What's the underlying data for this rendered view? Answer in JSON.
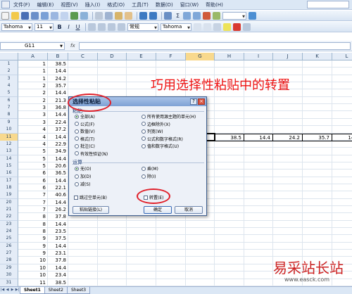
{
  "menubar": {
    "items": [
      {
        "label": "文件(F)",
        "name": "menu-file"
      },
      {
        "label": "编辑(E)",
        "name": "menu-edit"
      },
      {
        "label": "视图(V)",
        "name": "menu-view"
      },
      {
        "label": "插入(I)",
        "name": "menu-insert"
      },
      {
        "label": "格式(O)",
        "name": "menu-format"
      },
      {
        "label": "工具(T)",
        "name": "menu-tools"
      },
      {
        "label": "数据(D)",
        "name": "menu-data"
      },
      {
        "label": "窗口(W)",
        "name": "menu-window"
      },
      {
        "label": "帮助(H)",
        "name": "menu-help"
      }
    ]
  },
  "toolbar": {
    "font_name": "Tahoma",
    "font_size": "11",
    "style_combo": "常规",
    "style_font": "Tahoma",
    "bold": "B",
    "italic": "I",
    "underline": "U"
  },
  "formula_bar": {
    "name_box": "G11",
    "fx": "fx"
  },
  "columns": [
    "A",
    "B",
    "C",
    "D",
    "E",
    "F",
    "G",
    "H",
    "I",
    "J",
    "K",
    "L"
  ],
  "selected_column": "G",
  "rows": [
    {
      "num": "1",
      "a": "1",
      "b": "38.5"
    },
    {
      "num": "2",
      "a": "1",
      "b": "14.4"
    },
    {
      "num": "3",
      "a": "1",
      "b": "24.2"
    },
    {
      "num": "4",
      "a": "2",
      "b": "35.7"
    },
    {
      "num": "5",
      "a": "2",
      "b": "14.4"
    },
    {
      "num": "6",
      "a": "2",
      "b": "21.3"
    },
    {
      "num": "7",
      "a": "3",
      "b": "36.8"
    },
    {
      "num": "8",
      "a": "3",
      "b": "14.4"
    },
    {
      "num": "9",
      "a": "3",
      "b": "22.4"
    },
    {
      "num": "10",
      "a": "4",
      "b": "37.2"
    },
    {
      "num": "11",
      "a": "4",
      "b": "14.4"
    },
    {
      "num": "12",
      "a": "4",
      "b": "22.9"
    },
    {
      "num": "13",
      "a": "5",
      "b": "34.9"
    },
    {
      "num": "14",
      "a": "5",
      "b": "14.4"
    },
    {
      "num": "15",
      "a": "5",
      "b": "20.6"
    },
    {
      "num": "16",
      "a": "6",
      "b": "36.5"
    },
    {
      "num": "17",
      "a": "6",
      "b": "14.4"
    },
    {
      "num": "18",
      "a": "6",
      "b": "22.1"
    },
    {
      "num": "19",
      "a": "7",
      "b": "40.6"
    },
    {
      "num": "20",
      "a": "7",
      "b": "14.4"
    },
    {
      "num": "21",
      "a": "7",
      "b": "26.2"
    },
    {
      "num": "22",
      "a": "8",
      "b": "37.8"
    },
    {
      "num": "23",
      "a": "8",
      "b": "14.4"
    },
    {
      "num": "24",
      "a": "8",
      "b": "23.5"
    },
    {
      "num": "25",
      "a": "9",
      "b": "37.5"
    },
    {
      "num": "26",
      "a": "9",
      "b": "14.4"
    },
    {
      "num": "27",
      "a": "9",
      "b": "23.1"
    },
    {
      "num": "28",
      "a": "10",
      "b": "37.8"
    },
    {
      "num": "29",
      "a": "10",
      "b": "14.4"
    },
    {
      "num": "30",
      "a": "10",
      "b": "23.4"
    },
    {
      "num": "31",
      "a": "11",
      "b": "38.5"
    }
  ],
  "selected_row": "11",
  "transposed_row": {
    "g": "",
    "h": "38.5",
    "i": "14.4",
    "j": "24.2",
    "k": "35.7",
    "l": "14.4"
  },
  "title_text": "巧用选择性粘贴中的转置",
  "sheets": [
    "Sheet1",
    "Sheet2",
    "Sheet3"
  ],
  "active_sheet": "Sheet1",
  "dialog": {
    "title": "选择性粘贴",
    "paste_group": "粘贴",
    "paste_left": [
      "全部(A)",
      "公式(F)",
      "数值(V)",
      "格式(T)",
      "批注(C)",
      "有效性验证(N)"
    ],
    "paste_right": [
      "所有使用源主题的单元(H)",
      "边框除外(X)",
      "列宽(W)",
      "公式和数字格式(R)",
      "值和数字格式(U)"
    ],
    "operation_group": "运算",
    "op_left": [
      "无(O)",
      "加(D)",
      "减(S)"
    ],
    "op_right": [
      "乘(M)",
      "除(I)"
    ],
    "skip_blanks": "跳过空单元(B)",
    "transpose": "转置(E)",
    "paste_link": "粘贴链接(L)",
    "ok": "确定",
    "cancel": "取消",
    "help": "?",
    "close": "×"
  },
  "watermark": {
    "cn": "易采站长站",
    "url": "www.easck.com"
  },
  "colors": {
    "accent_red": "#e0202a",
    "selection": "#f8d98e",
    "title_red": "#ee1111"
  }
}
